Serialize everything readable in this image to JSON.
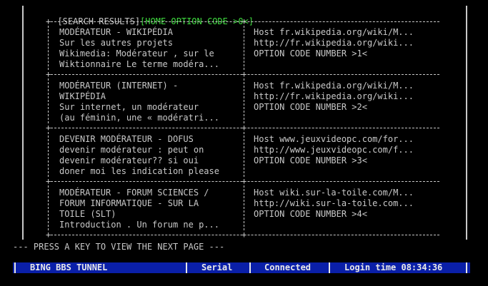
{
  "header": {
    "title": "[SEARCH RESULTS]",
    "home_option": "[HOME OPTION CODE >0<]"
  },
  "results": [
    {
      "title": [
        "MODÉRATEUR - WIKIPÉDIA"
      ],
      "snippet": [
        "Sur les autres projets",
        "Wikimedia: Modérateur , sur le",
        "Wiktionnaire Le terme modéra..."
      ],
      "host": "Host fr.wikipedia.org/wiki/M...",
      "url": "http://fr.wikipedia.org/wiki...",
      "option": "OPTION CODE NUMBER >1<"
    },
    {
      "title": [
        "MODÉRATEUR (INTERNET) -",
        "WIKIPÉDIA"
      ],
      "snippet": [
        "Sur internet, un modérateur",
        "(au féminin, une « modératri..."
      ],
      "host": "Host fr.wikipedia.org/wiki/M...",
      "url": "http://fr.wikipedia.org/wiki...",
      "option": "OPTION CODE NUMBER >2<"
    },
    {
      "title": [
        "DEVENIR MODÉRATEUR - DOFUS"
      ],
      "snippet": [
        "devenir modérateur : peut on",
        "devenir modérateur?? si oui",
        "doner moi les indication please"
      ],
      "host": "Host www.jeuxvideopc.com/for...",
      "url": "http://www.jeuxvideopc.com/f...",
      "option": "OPTION CODE NUMBER >3<"
    },
    {
      "title": [
        "MODÉRATEUR - FORUM SCIENCES /",
        "FORUM INFORMATIQUE - SUR LA",
        "TOILE (SLT)"
      ],
      "snippet": [
        "Introduction . Un forum ne p..."
      ],
      "host": "Host wiki.sur-la-toile.com/M...",
      "url": "http://wiki.sur-la-toile.com...",
      "option": "OPTION CODE NUMBER >4<"
    }
  ],
  "footer": {
    "prompt": "--- PRESS A KEY TO VIEW THE NEXT PAGE ---"
  },
  "status_bar": {
    "name": "BING BBS TUNNEL",
    "mode": "Serial",
    "state": "Connected",
    "login": "Login time 08:34:36"
  },
  "colors": {
    "background": "#000000",
    "text": "#c8c8c8",
    "highlight": "#3fdc3f",
    "status_bar": "#0a1fa8"
  }
}
